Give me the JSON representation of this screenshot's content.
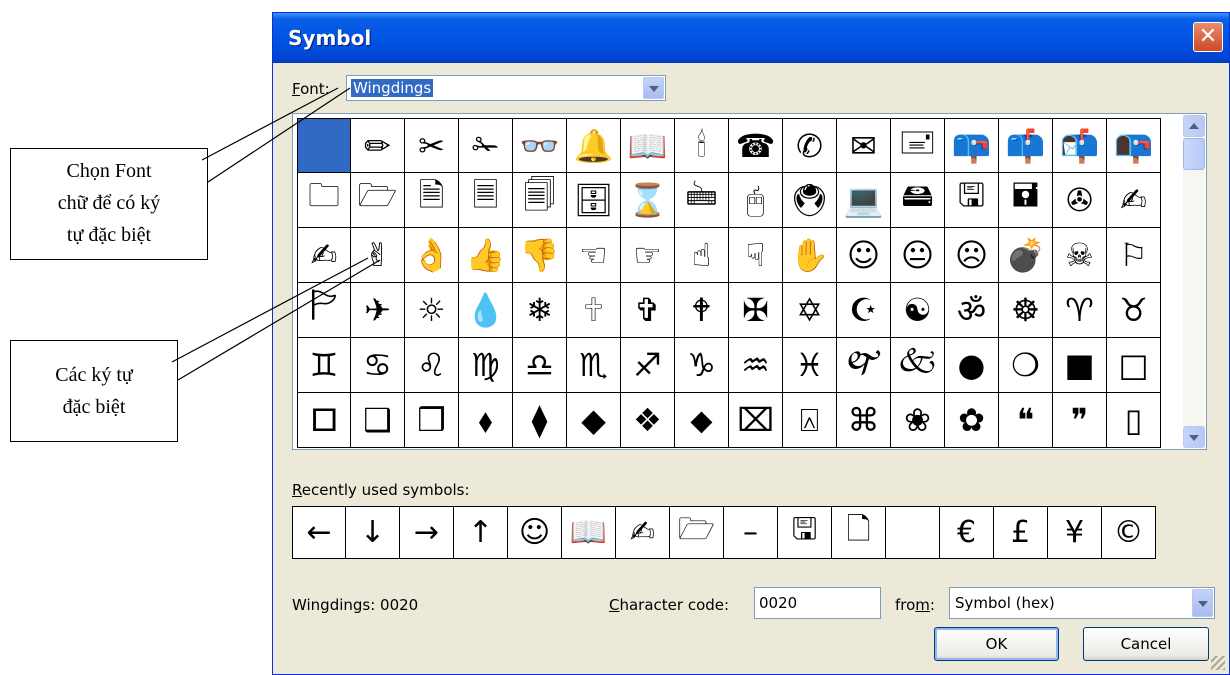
{
  "window": {
    "title": "Symbol",
    "close_glyph": "✕"
  },
  "annotations": {
    "font_callout": [
      "Chọn Font",
      "chữ để có ký",
      "tự đặc biệt"
    ],
    "symbols_callout": [
      "Các ký tự",
      "đặc biệt"
    ]
  },
  "font": {
    "label_accel": "F",
    "label_rest": "ont:",
    "value": "Wingdings"
  },
  "grid": {
    "selected_index": 0,
    "symbols": [
      "",
      "✏",
      "✂",
      "✁",
      "👓",
      "🔔",
      "📖",
      "🕯",
      "☎",
      "✆",
      "✉",
      "🖃",
      "📪",
      "📫",
      "📬",
      "📭",
      "🗀",
      "🗁",
      "🗎",
      "🗏",
      "🗐",
      "🗄",
      "⌛",
      "🖮",
      "🖰",
      "🖲",
      "💻",
      "🖴",
      "🖫",
      "🖬",
      "✇",
      "✍",
      "✍",
      "✌",
      "👌",
      "👍",
      "👎",
      "☜",
      "☞",
      "☝",
      "☟",
      "✋",
      "☺",
      "😐",
      "☹",
      "💣",
      "☠",
      "⚐",
      "🏱",
      "✈",
      "☼",
      "💧",
      "❄",
      "🕆",
      "✞",
      "🕈",
      "✠",
      "✡",
      "☪",
      "☯",
      "ॐ",
      "☸",
      "♈",
      "♉",
      "♊",
      "♋",
      "♌",
      "♍",
      "♎",
      "♏",
      "♐",
      "♑",
      "♒",
      "♓",
      "🙰",
      "🙵",
      "●",
      "❍",
      "■",
      "□",
      "🞐",
      "❑",
      "❒",
      "⬧",
      "⧫",
      "◆",
      "❖",
      "⬥",
      "⌧",
      "⍓",
      "⌘",
      "❀",
      "✿",
      "❝",
      "❞",
      "▯"
    ]
  },
  "recent": {
    "label_accel": "R",
    "label_rest": "ecently used symbols:",
    "symbols": [
      "←",
      "↓",
      "→",
      "↑",
      "☺",
      "📖",
      "✍",
      "🗁",
      "–",
      "🖫",
      "🗋",
      " ",
      "€",
      "£",
      "¥",
      "©"
    ]
  },
  "status": {
    "text": "Wingdings: 0020"
  },
  "char_code": {
    "label_accel": "C",
    "label_rest": "haracter code:",
    "value": "0020"
  },
  "from": {
    "label_pre": "fro",
    "label_accel": "m",
    "label_post": ":",
    "value": "Symbol (hex)"
  },
  "buttons": {
    "ok": "OK",
    "cancel": "Cancel"
  }
}
